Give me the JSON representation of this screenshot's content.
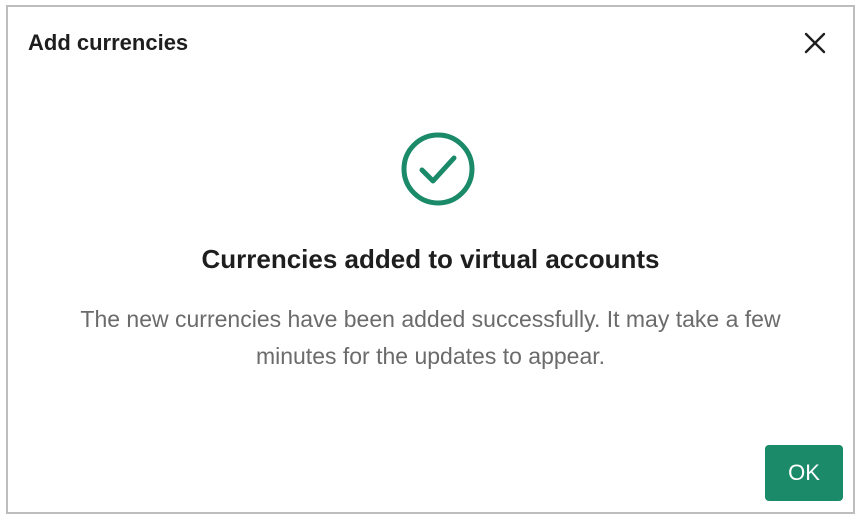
{
  "dialog": {
    "title": "Add currencies",
    "close_icon": "close-icon",
    "status_icon": "check-circle-icon",
    "heading": "Currencies added to virtual accounts",
    "message": "The new currencies have been added successfully. It may take a few minutes for the updates to appear.",
    "ok_label": "OK"
  },
  "colors": {
    "accent": "#1a8a68",
    "title_text": "#1e1e1e",
    "body_text": "#6b6b6b",
    "border": "#bdbdbd"
  }
}
